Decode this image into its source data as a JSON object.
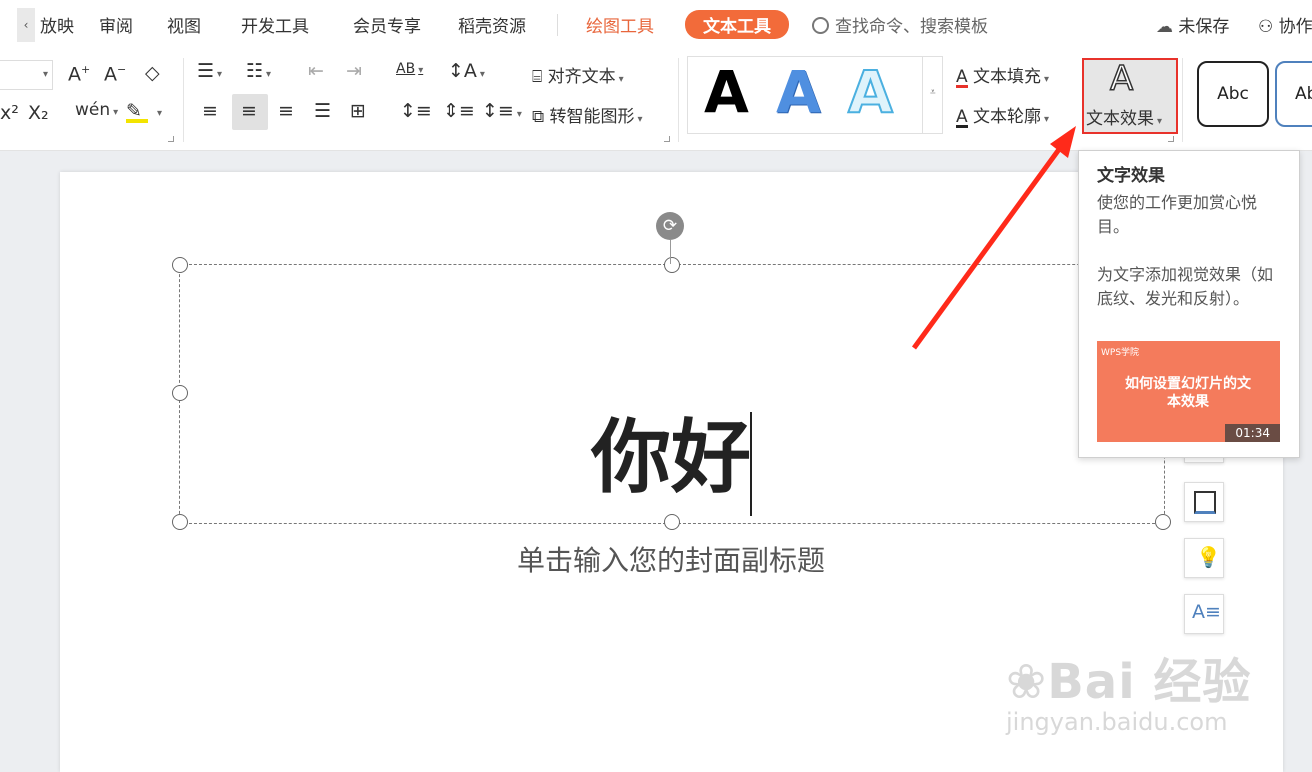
{
  "menu": {
    "tabs": [
      "放映",
      "审阅",
      "视图",
      "开发工具",
      "会员专享",
      "稻壳资源"
    ],
    "drawing_tools": "绘图工具",
    "text_tools": "文本工具",
    "search_placeholder": "查找命令、搜索模板",
    "unsaved": "未保存",
    "collab": "协作"
  },
  "ribbon": {
    "align_text": "对齐文本",
    "smart_shape": "转智能图形",
    "text_fill": "文本填充",
    "text_outline": "文本轮廓",
    "text_effect": "文本效果",
    "style_preset_1": "Abc",
    "style_preset_2": "Abc",
    "wordart_letter": "A"
  },
  "slide": {
    "title": "你好",
    "subtitle": "单击输入您的封面副标题"
  },
  "tooltip": {
    "heading": "文字效果",
    "desc1": "使您的工作更加赏心悦目。",
    "desc2": "为文字添加视觉效果（如底纹、发光和反射）。",
    "video_brand": "WPS学院",
    "video_title": "如何设置幻灯片的文本效果",
    "video_duration": "01:34"
  },
  "watermark": {
    "brand": "Bai 经验",
    "url": "jingyan.baidu.com"
  },
  "colors": {
    "accent_orange": "#f26b3a",
    "highlight_red": "#e8322b",
    "video_bg": "#f47b5c"
  }
}
